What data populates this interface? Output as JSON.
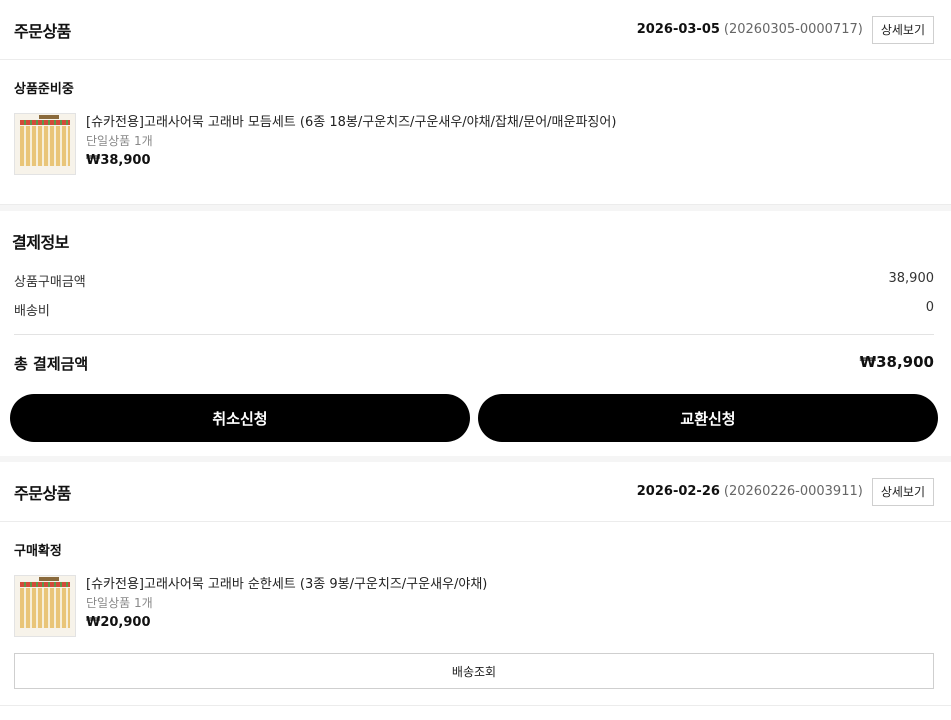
{
  "orders": [
    {
      "section_title": "주문상품",
      "date": "2026-03-05",
      "order_no": "(20260305-0000717)",
      "detail_label": "상세보기",
      "status": "상품준비중",
      "product": {
        "name": "[슈카전용]고래사어묵 고래바 모듬세트 (6종 18봉/구운치즈/구운새우/야채/잡채/문어/매운파징어)",
        "option": "단일상품 1개",
        "price": "₩38,900"
      }
    },
    {
      "section_title": "주문상품",
      "date": "2026-02-26",
      "order_no": "(20260226-0003911)",
      "detail_label": "상세보기",
      "status": "구매확정",
      "product": {
        "name": "[슈카전용]고래사어묵 고래바 순한세트 (3종 9봉/구운치즈/구운새우/야채)",
        "option": "단일상품 1개",
        "price": "₩20,900"
      },
      "track_label": "배송조회"
    }
  ],
  "payment": {
    "title": "결제정보",
    "product_amount_label": "상품구매금액",
    "product_amount": "38,900",
    "shipping_label": "배송비",
    "shipping": "0",
    "total_label": "총 결제금액",
    "total": "₩38,900"
  },
  "actions": {
    "cancel_label": "취소신청",
    "exchange_label": "교환신청"
  },
  "colors": {
    "button_bg": "#000000",
    "divider": "#ececec",
    "band": "#f5f5f5"
  }
}
